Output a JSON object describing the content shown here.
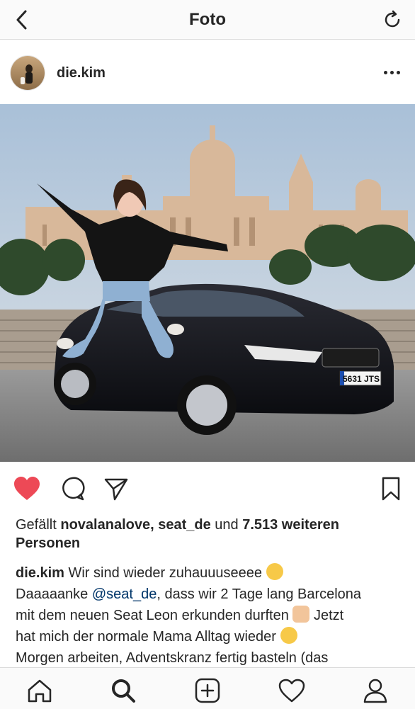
{
  "topbar": {
    "title": "Foto"
  },
  "post": {
    "username": "die.kim",
    "photo": {
      "license_plate": "5631 JTS"
    }
  },
  "likes": {
    "prefix": "Gefällt",
    "users": "novalanalove, seat_de",
    "conjunction": "und",
    "count": "7.513 weiteren",
    "suffix": "Personen"
  },
  "caption": {
    "author": "die.kim",
    "line1": "Wir sind wieder zuhauuuseeee",
    "line2_a": "Daaaaanke",
    "mention": "@seat_de",
    "line2_b": ", dass wir 2 Tage lang Barcelona",
    "line3": "mit dem neuen Seat Leon erkunden durften",
    "line3_b": "Jetzt",
    "line4": "hat mich der normale Mama Alltag wieder",
    "line5": "Morgen arbeiten, Adventskranz fertig basteln (das"
  },
  "colors": {
    "heart": "#ed4956",
    "text": "#262626",
    "mention": "#003569",
    "bar_bg": "#fafafa",
    "divider": "#dbdbdb"
  },
  "icons": [
    "back-arrow-icon",
    "refresh-icon",
    "more-icon",
    "heart-icon",
    "comment-icon",
    "share-icon",
    "bookmark-icon",
    "home-icon",
    "search-icon",
    "add-icon",
    "activity-icon",
    "profile-icon"
  ]
}
